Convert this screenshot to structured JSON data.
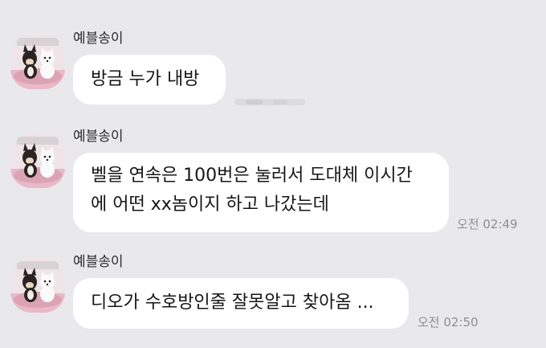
{
  "chat": {
    "messages": [
      {
        "sender": "예블송이",
        "lines": [
          "방금 누가 내방"
        ],
        "time": ""
      },
      {
        "sender": "예블송이",
        "lines": [
          "벨을 연속은 100번은 눌러서 도대체 이시간",
          "에 어떤 xx놈이지 하고 나갔는데"
        ],
        "time": "오전 02:49"
      },
      {
        "sender": "예블송이",
        "lines": [
          "디오가 수호방인줄 잘못알고 찾아옴 ..."
        ],
        "time": "오전 02:50"
      }
    ]
  },
  "colors": {
    "background": "#e9e9eb",
    "bubble": "#ffffff",
    "time_text": "#8e8e93",
    "avatar_bg": "#f1e7ea"
  },
  "icons": {
    "avatar": "profile-photo-two-dogs"
  }
}
